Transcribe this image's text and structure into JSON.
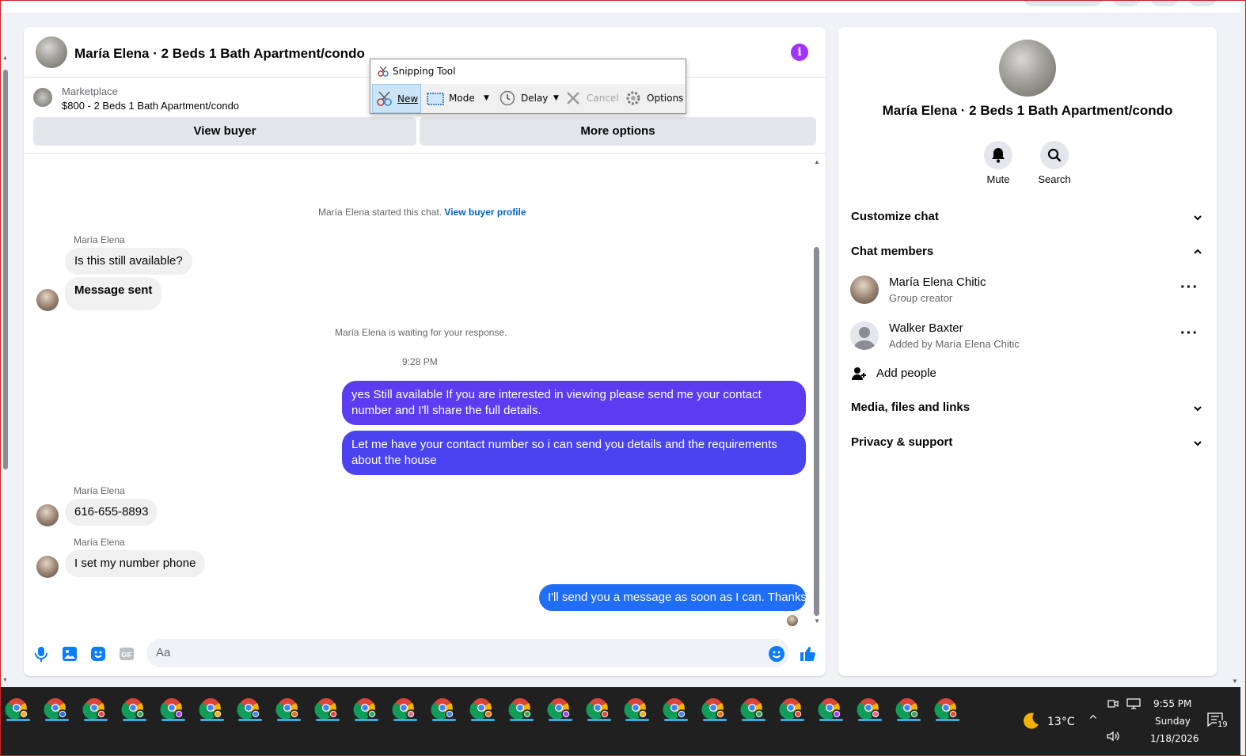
{
  "chat": {
    "title": "María Elena · 2 Beds 1 Bath Apartment/condo",
    "marketplace_label": "Marketplace",
    "listing": "$800 - 2 Beds 1 Bath Apartment/condo",
    "view_buyer": "View buyer",
    "more_options": "More options",
    "started_text": "María Elena started this chat.",
    "view_buyer_profile": "View buyer profile",
    "waiting_text": "María Elena is waiting for your response.",
    "timestamp": "9:28 PM",
    "messages": [
      {
        "sender": "María Elena",
        "text": "Is this still available?"
      },
      {
        "text": "Message sent"
      },
      {
        "text": "yes Still available If you are interested in viewing please send me your contact number and I'll share the full details."
      },
      {
        "text": "Let me have your contact number so i can send you details and the requirements about the house"
      },
      {
        "sender": "María Elena",
        "text": "616-655-8893"
      },
      {
        "sender": "María Elena",
        "text": "I set my number phone"
      },
      {
        "text": "I'll send you a message as soon as I can. Thanks"
      }
    ],
    "input_placeholder": "Aa"
  },
  "snipping_tool": {
    "title": "Snipping Tool",
    "new": "New",
    "mode": "Mode",
    "delay": "Delay",
    "cancel": "Cancel",
    "options": "Options"
  },
  "side": {
    "title": "María Elena · 2 Beds 1 Bath Apartment/condo",
    "mute": "Mute",
    "search": "Search",
    "customize_chat": "Customize chat",
    "chat_members": "Chat members",
    "members": [
      {
        "name": "María Elena Chitic",
        "sub": "Group creator"
      },
      {
        "name": "Walker Baxter",
        "sub": "Added by María Elena Chitic"
      }
    ],
    "add_people": "Add people",
    "media": "Media, files and links",
    "privacy": "Privacy & support"
  },
  "taskbar": {
    "weather": "13°C",
    "time": "9:55 PM",
    "day": "Sunday",
    "date": "1/18/2026",
    "notifications": "19"
  },
  "colors": {
    "bubble_out_1": "#5b3cf0",
    "bubble_out_2": "#4a43f0",
    "bubble_out_3": "#1f6ef5",
    "accent_blue": "#0a7cff",
    "info_purple": "#a033ff"
  }
}
